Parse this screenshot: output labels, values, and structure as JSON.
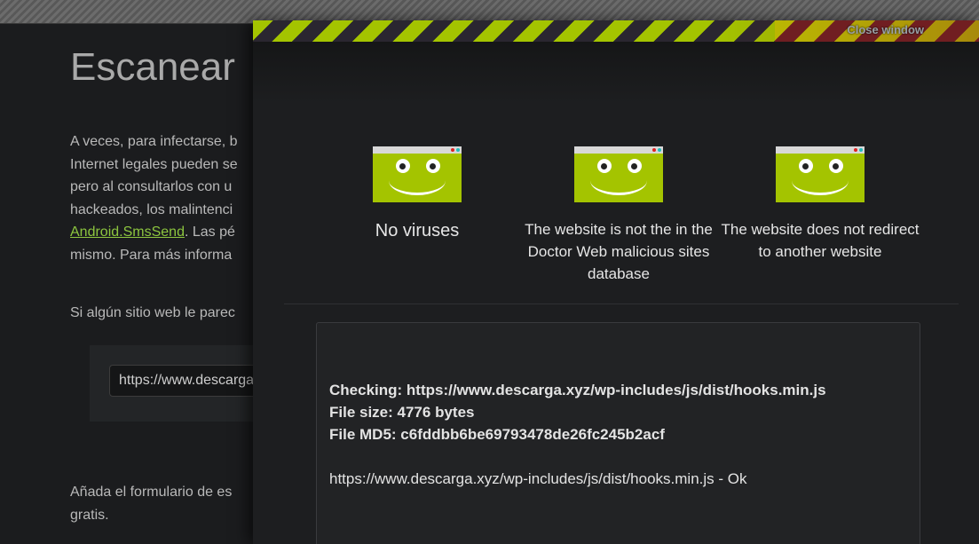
{
  "background": {
    "title": "Escanear",
    "paragraph_lines": [
      "A veces, para infectarse, b",
      "Internet legales pueden se",
      "pero al consultarlos con u",
      "hackeados, los malintenci"
    ],
    "link_text": "Android.SmsSend",
    "link_after": ". Las pé",
    "last_line": "mismo. Para más informa",
    "question": "Si algún sitio web le parec",
    "url_input_value": "https://www.descarga",
    "footer_lines": [
      "Añada el formulario de es",
      "gratis."
    ]
  },
  "modal": {
    "close_label": "Close window",
    "results": [
      {
        "label": "No viruses"
      },
      {
        "label": "The website is not the in the Doctor Web malicious sites database"
      },
      {
        "label": "The website does not redirect to another website"
      }
    ],
    "report": {
      "checking": "Checking: https://www.descarga.xyz/wp-includes/js/dist/hooks.min.js",
      "file_size": "File size: 4776 bytes",
      "file_md5": "File MD5: c6fddbb6be69793478de26fc245b2acf",
      "result_line": "https://www.descarga.xyz/wp-includes/js/dist/hooks.min.js - Ok"
    }
  },
  "colors": {
    "accent_green": "#a4c400",
    "link_green": "#8dc63f"
  },
  "icons": {
    "result_icon": "smiling-window-icon"
  }
}
